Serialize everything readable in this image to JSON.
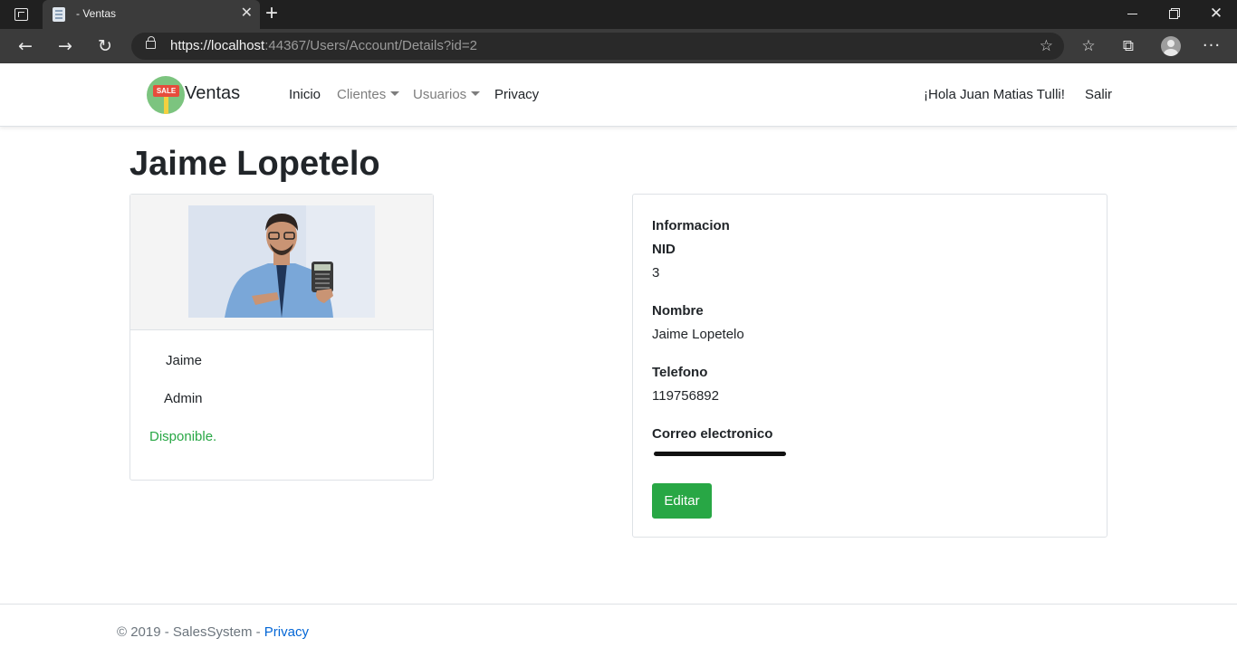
{
  "browser": {
    "tab_title": "- Ventas",
    "tab_close": "✕",
    "new_tab": "+",
    "url_host": "https://localhost",
    "url_rest": ":44367/Users/Account/Details?id=2",
    "icons": [
      "tab-actions-icon",
      "page-icon",
      "close-icon",
      "plus-icon",
      "minimize-icon",
      "restore-icon",
      "close-window-icon",
      "back-arrow-icon",
      "forward-arrow-icon",
      "reload-icon",
      "lock-icon",
      "add-favorite-icon",
      "favorites-icon",
      "collections-icon",
      "profile-icon",
      "more-icon"
    ]
  },
  "navbar": {
    "logo_sign": "SALE",
    "brand": "Ventas",
    "links": {
      "inicio": "Inicio",
      "clientes": "Clientes",
      "usuarios": "Usuarios",
      "privacy": "Privacy"
    },
    "greeting": "¡Hola Juan Matias Tulli!",
    "logout": "Salir"
  },
  "page": {
    "title": "Jaime Lopetelo"
  },
  "profile_card": {
    "first_name": "Jaime",
    "role": "Admin",
    "status": "Disponible."
  },
  "info_card": {
    "heading": "Informacion",
    "nid_label": "NID",
    "nid_value": "3",
    "name_label": "Nombre",
    "name_value": "Jaime Lopetelo",
    "phone_label": "Telefono",
    "phone_value": "119756892",
    "email_label": "Correo electronico",
    "edit_button": "Editar"
  },
  "footer": {
    "copyright": "© 2019 - SalesSystem - ",
    "privacy_link": "Privacy"
  },
  "colors": {
    "success": "#28a745",
    "link": "#0366d6",
    "browser_dark": "#202020",
    "browser_toolbar": "#3b3b3b"
  }
}
